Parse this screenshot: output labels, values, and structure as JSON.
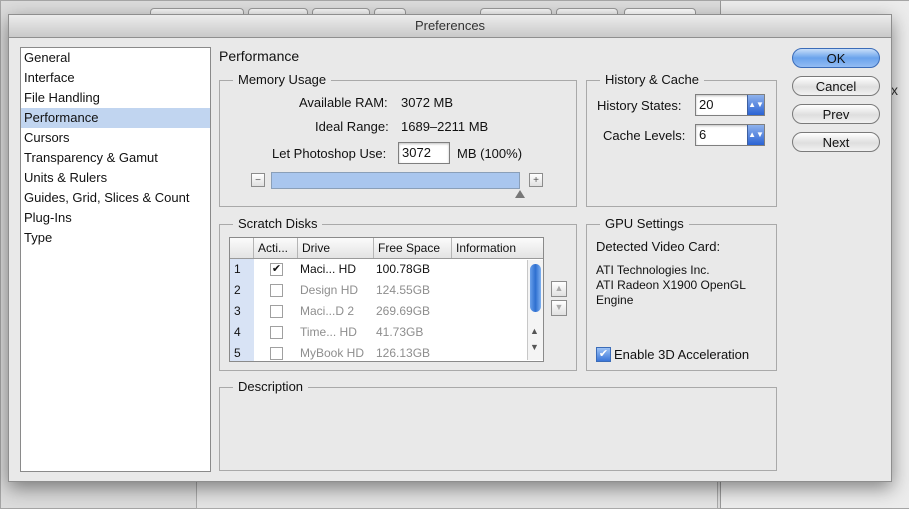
{
  "dialog": {
    "title": "Preferences"
  },
  "sidebar": {
    "items": [
      {
        "label": "General"
      },
      {
        "label": "Interface"
      },
      {
        "label": "File Handling"
      },
      {
        "label": "Performance",
        "selected": true
      },
      {
        "label": "Cursors"
      },
      {
        "label": "Transparency & Gamut"
      },
      {
        "label": "Units & Rulers"
      },
      {
        "label": "Guides, Grid, Slices & Count"
      },
      {
        "label": "Plug-Ins"
      },
      {
        "label": "Type"
      }
    ]
  },
  "panel": {
    "title": "Performance"
  },
  "memory": {
    "legend": "Memory Usage",
    "available_label": "Available RAM:",
    "available_value": "3072 MB",
    "ideal_label": "Ideal Range:",
    "ideal_value": "1689–2211 MB",
    "let_use_label": "Let Photoshop Use:",
    "let_use_value": "3072",
    "let_use_suffix": "MB (100%)",
    "slider_fraction": 1.0
  },
  "history": {
    "legend": "History & Cache",
    "states_label": "History States:",
    "states_value": "20",
    "cache_label": "Cache Levels:",
    "cache_value": "6"
  },
  "scratch": {
    "legend": "Scratch Disks",
    "columns": [
      "Acti...",
      "Drive",
      "Free Space",
      "Information"
    ],
    "rows": [
      {
        "num": "1",
        "active": true,
        "drive": "Maci... HD",
        "free": "100.78GB",
        "info": ""
      },
      {
        "num": "2",
        "active": false,
        "drive": "Design HD",
        "free": "124.55GB",
        "info": ""
      },
      {
        "num": "3",
        "active": false,
        "drive": "Maci...D 2",
        "free": "269.69GB",
        "info": ""
      },
      {
        "num": "4",
        "active": false,
        "drive": "Time... HD",
        "free": "41.73GB",
        "info": ""
      },
      {
        "num": "5",
        "active": false,
        "drive": "MyBook HD",
        "free": "126.13GB",
        "info": ""
      }
    ]
  },
  "gpu": {
    "legend": "GPU Settings",
    "detected_label": "Detected Video Card:",
    "card_lines": [
      "ATI Technologies Inc.",
      "ATI Radeon X1900 OpenGL",
      "Engine"
    ],
    "enable_label": "Enable 3D Acceleration",
    "enable_checked": true
  },
  "description": {
    "legend": "Description"
  },
  "buttons": {
    "ok": "OK",
    "cancel": "Cancel",
    "prev": "Prev",
    "next": "Next"
  },
  "glyphs": {
    "check": "✔",
    "minus": "−",
    "plus": "+",
    "up": "▲",
    "down": "▼",
    "combo": "▲▼"
  },
  "background": {
    "close_glyph": "x"
  },
  "colors": {
    "selection": "#c1d5f0",
    "accent": "#2b63d4"
  }
}
